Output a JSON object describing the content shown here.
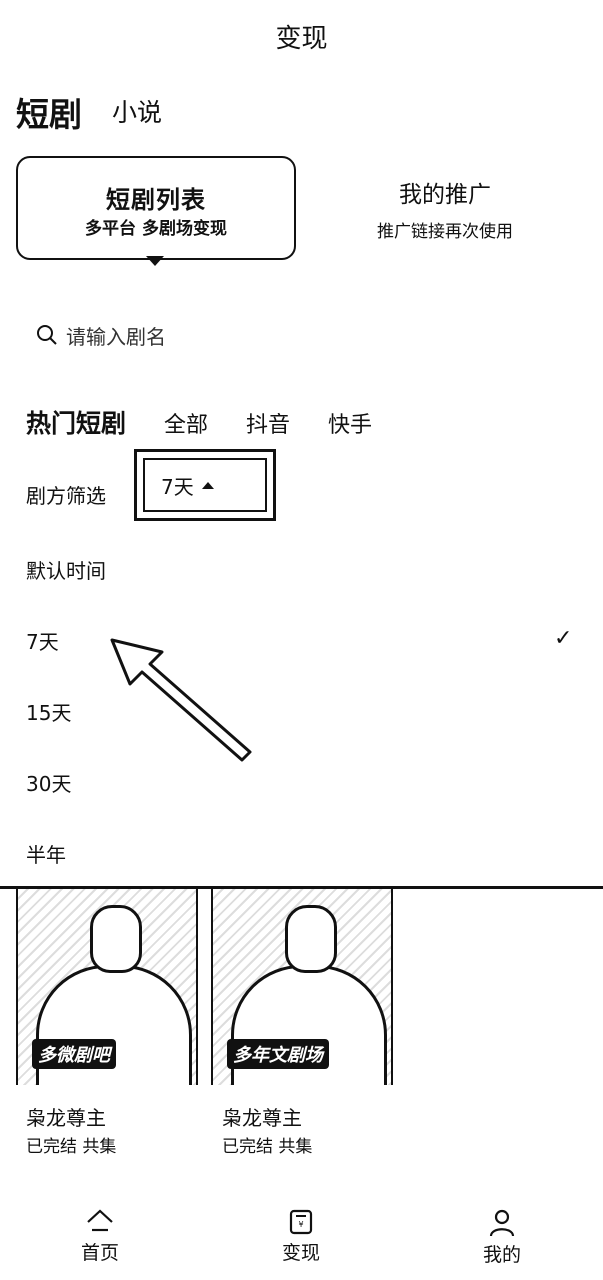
{
  "page_title": "变现",
  "main_tabs": [
    {
      "label": "短剧"
    },
    {
      "label": "小说"
    }
  ],
  "cards": {
    "active": {
      "title": "短剧列表",
      "subtitle": "多平台 多剧场变现"
    },
    "inactive": {
      "title": "我的推广",
      "subtitle": "推广链接再次使用"
    }
  },
  "search": {
    "placeholder": "请输入剧名",
    "icon": "search-icon"
  },
  "filter": {
    "hot_label": "热门短剧",
    "tabs": [
      "全部",
      "抖音",
      "快手"
    ],
    "drama_filter_label": "剧方筛选",
    "selected": "7天"
  },
  "options": [
    {
      "label": "默认时间"
    },
    {
      "label": "7天",
      "checked": true
    },
    {
      "label": "15天"
    },
    {
      "label": "30天"
    },
    {
      "label": "半年"
    }
  ],
  "check_icon": "✓",
  "items": [
    {
      "tag": "多微剧吧",
      "title": "枭龙尊主",
      "status": "已完结 共集"
    },
    {
      "tag": "多年文剧场",
      "title": "枭龙尊主",
      "status": "已完结 共集"
    }
  ],
  "bottom_nav": [
    {
      "label": "首页",
      "icon": "home-icon"
    },
    {
      "label": "变现",
      "icon": "wallet-icon"
    },
    {
      "label": "我的",
      "icon": "user-icon"
    }
  ]
}
